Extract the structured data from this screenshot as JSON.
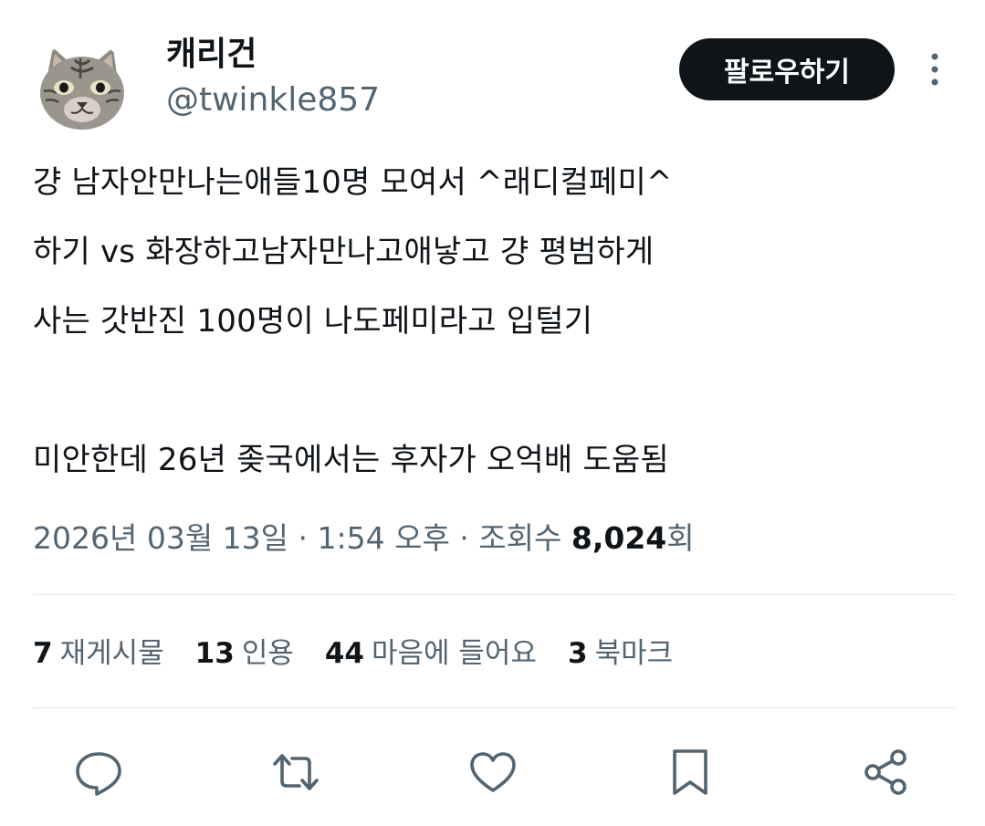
{
  "author": {
    "display_name": "캐리건",
    "handle": "@twinkle857",
    "avatar_icon": "cat-avatar"
  },
  "follow_label": "팔로우하기",
  "tweet_lines": [
    "걍 남자안만나는애들10명 모여서 ^래디컬페미^",
    "하기 vs 화장하고남자만나고애낳고 걍 평범하게",
    "사는 갓반진 100명이 나도페미라고 입털기",
    "",
    "미안한데 26년 좆국에서는 후자가 오억배 도움됨"
  ],
  "meta": {
    "datetime": "2026년 03월 13일 · 1:54 오후 · 조회수 ",
    "views": "8,024",
    "views_suffix": "회"
  },
  "stats": [
    {
      "num": "7",
      "label": "재게시물"
    },
    {
      "num": "13",
      "label": "인용"
    },
    {
      "num": "44",
      "label": "마음에 들어요"
    },
    {
      "num": "3",
      "label": "북마크"
    }
  ],
  "actions": [
    "reply-icon",
    "repost-icon",
    "like-icon",
    "bookmark-icon",
    "share-icon"
  ],
  "colors": {
    "text": "#0f1419",
    "secondary": "#536471",
    "icon": "#536471",
    "button_bg": "#0f1419",
    "divider": "#e3e6e8"
  }
}
